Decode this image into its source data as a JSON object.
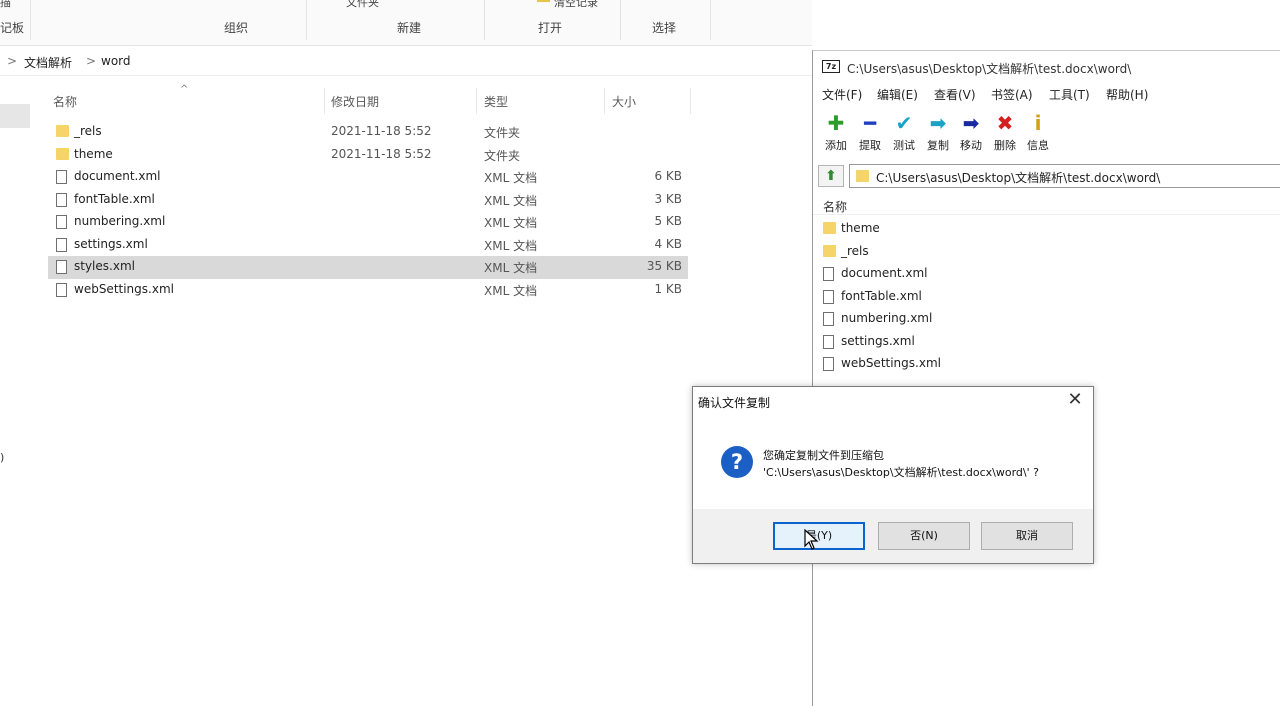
{
  "explorer": {
    "ribbon": {
      "top_labels": [
        "描",
        "文件夹",
        "清空记录"
      ],
      "groups": [
        "记板",
        "组织",
        "新建",
        "打开",
        "选择"
      ]
    },
    "breadcrumb": {
      "sep": ">",
      "items": [
        "文档解析",
        "word"
      ]
    },
    "nav_mark": ")",
    "columns": {
      "name": "名称",
      "date": "修改日期",
      "type": "类型",
      "size": "大小"
    },
    "files": [
      {
        "name": "_rels",
        "date": "2021-11-18 5:52",
        "type": "文件夹",
        "size": "",
        "kind": "folder",
        "selected": false
      },
      {
        "name": "theme",
        "date": "2021-11-18 5:52",
        "type": "文件夹",
        "size": "",
        "kind": "folder",
        "selected": false
      },
      {
        "name": "document.xml",
        "date": "",
        "type": "XML 文档",
        "size": "6 KB",
        "kind": "file",
        "selected": false
      },
      {
        "name": "fontTable.xml",
        "date": "",
        "type": "XML 文档",
        "size": "3 KB",
        "kind": "file",
        "selected": false
      },
      {
        "name": "numbering.xml",
        "date": "",
        "type": "XML 文档",
        "size": "5 KB",
        "kind": "file",
        "selected": false
      },
      {
        "name": "settings.xml",
        "date": "",
        "type": "XML 文档",
        "size": "4 KB",
        "kind": "file",
        "selected": false
      },
      {
        "name": "styles.xml",
        "date": "",
        "type": "XML 文档",
        "size": "35 KB",
        "kind": "file",
        "selected": true
      },
      {
        "name": "webSettings.xml",
        "date": "",
        "type": "XML 文档",
        "size": "1 KB",
        "kind": "file",
        "selected": false
      }
    ]
  },
  "zip": {
    "logo": "7z",
    "title": "C:\\Users\\asus\\Desktop\\文档解析\\test.docx\\word\\",
    "menu": [
      "文件(F)",
      "编辑(E)",
      "查看(V)",
      "书签(A)",
      "工具(T)",
      "帮助(H)"
    ],
    "toolbar": [
      {
        "label": "添加",
        "glyph": "✚",
        "color": "#2a9d2a"
      },
      {
        "label": "提取",
        "glyph": "━",
        "color": "#1f3fbf"
      },
      {
        "label": "测试",
        "glyph": "✔",
        "color": "#1aa3c7"
      },
      {
        "label": "复制",
        "glyph": "➡",
        "color": "#1aa3c7"
      },
      {
        "label": "移动",
        "glyph": "➡",
        "color": "#1a2aa0"
      },
      {
        "label": "删除",
        "glyph": "✖",
        "color": "#d42020"
      },
      {
        "label": "信息",
        "glyph": "i",
        "color": "#d4a017"
      }
    ],
    "path": "C:\\Users\\asus\\Desktop\\文档解析\\test.docx\\word\\",
    "list_header": "名称",
    "items": [
      {
        "name": "theme",
        "kind": "folder"
      },
      {
        "name": "_rels",
        "kind": "folder"
      },
      {
        "name": "document.xml",
        "kind": "file"
      },
      {
        "name": "fontTable.xml",
        "kind": "file"
      },
      {
        "name": "numbering.xml",
        "kind": "file"
      },
      {
        "name": "settings.xml",
        "kind": "file"
      },
      {
        "name": "webSettings.xml",
        "kind": "file"
      }
    ]
  },
  "dialog": {
    "title": "确认文件复制",
    "close": "✕",
    "icon": "?",
    "message_line1": "您确定复制文件到压缩包",
    "message_line2": "'C:\\Users\\asus\\Desktop\\文档解析\\test.docx\\word\\' ?",
    "buttons": {
      "yes": "是(Y)",
      "no": "否(N)",
      "cancel": "取消"
    }
  }
}
